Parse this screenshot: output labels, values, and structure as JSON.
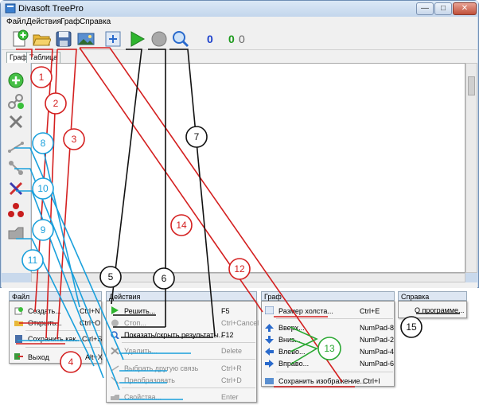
{
  "window": {
    "title": "Divasoft TreePro",
    "minimize_glyph": "—",
    "maximize_glyph": "□",
    "close_glyph": "✕"
  },
  "menubar": {
    "items": [
      "Файл",
      "Действия",
      "Граф",
      "Справка"
    ]
  },
  "toolbar": {
    "counter_blue": "0",
    "counter_green": "0",
    "counter_gray": "0",
    "icons": [
      "new-file-icon",
      "open-folder-icon",
      "save-icon",
      "save-image-icon",
      "canvas-size-icon",
      "play-icon",
      "stop-icon",
      "zoom-icon"
    ]
  },
  "tabs": [
    "Граф",
    "Таблица"
  ],
  "sidebar": {
    "icons": [
      "add-node-icon",
      "add-link-icon",
      "delete-icon",
      "select-other-link-icon",
      "transform-icon",
      "properties-icon",
      "cluster-icon",
      "node-shape-icon"
    ]
  },
  "menus": {
    "file": {
      "header": "Файл",
      "items": [
        {
          "label": "Создать...",
          "shortcut": "Ctrl+N"
        },
        {
          "label": "Открыть...",
          "shortcut": "Ctrl+O"
        },
        {
          "label": "Сохранить как...",
          "shortcut": "Ctrl+S"
        },
        {
          "label": "Выход",
          "shortcut": "Alt+X"
        }
      ]
    },
    "actions": {
      "header": "Действия",
      "items": [
        {
          "label": "Решить...",
          "shortcut": "F5"
        },
        {
          "label": "Стоп...",
          "shortcut": "Ctrl+Cancel"
        },
        {
          "label": "Показать/скрыть результаты...",
          "shortcut": "F12"
        },
        {
          "label": "Удалить...",
          "shortcut": "Delete"
        },
        {
          "label": "Выбрать другую связь",
          "shortcut": "Ctrl+R"
        },
        {
          "label": "Преобразовать",
          "shortcut": "Ctrl+D"
        },
        {
          "label": "Свойства...",
          "shortcut": "Enter"
        }
      ]
    },
    "graph": {
      "header": "Граф",
      "items": [
        {
          "label": "Размер холста...",
          "shortcut": "Ctrl+E"
        },
        {
          "label": "Вверх...",
          "shortcut": "NumPad-8"
        },
        {
          "label": "Вниз...",
          "shortcut": "NumPad-2"
        },
        {
          "label": "Влево...",
          "shortcut": "NumPad-4"
        },
        {
          "label": "Вправо...",
          "shortcut": "NumPad-6"
        },
        {
          "label": "Сохранить изображение...",
          "shortcut": "Ctrl+I"
        }
      ]
    },
    "help": {
      "header": "Справка",
      "items": [
        {
          "label": "О программе..."
        }
      ]
    }
  },
  "callouts": [
    "1",
    "2",
    "3",
    "4",
    "5",
    "6",
    "7",
    "8",
    "9",
    "10",
    "11",
    "12",
    "13",
    "14",
    "15"
  ],
  "colors": {
    "red": "#d42020",
    "blue": "#1aa0dc",
    "black": "#111111",
    "green": "#2aa832",
    "counter_blue": "#1a3fcc",
    "counter_green": "#1c9a1c"
  }
}
